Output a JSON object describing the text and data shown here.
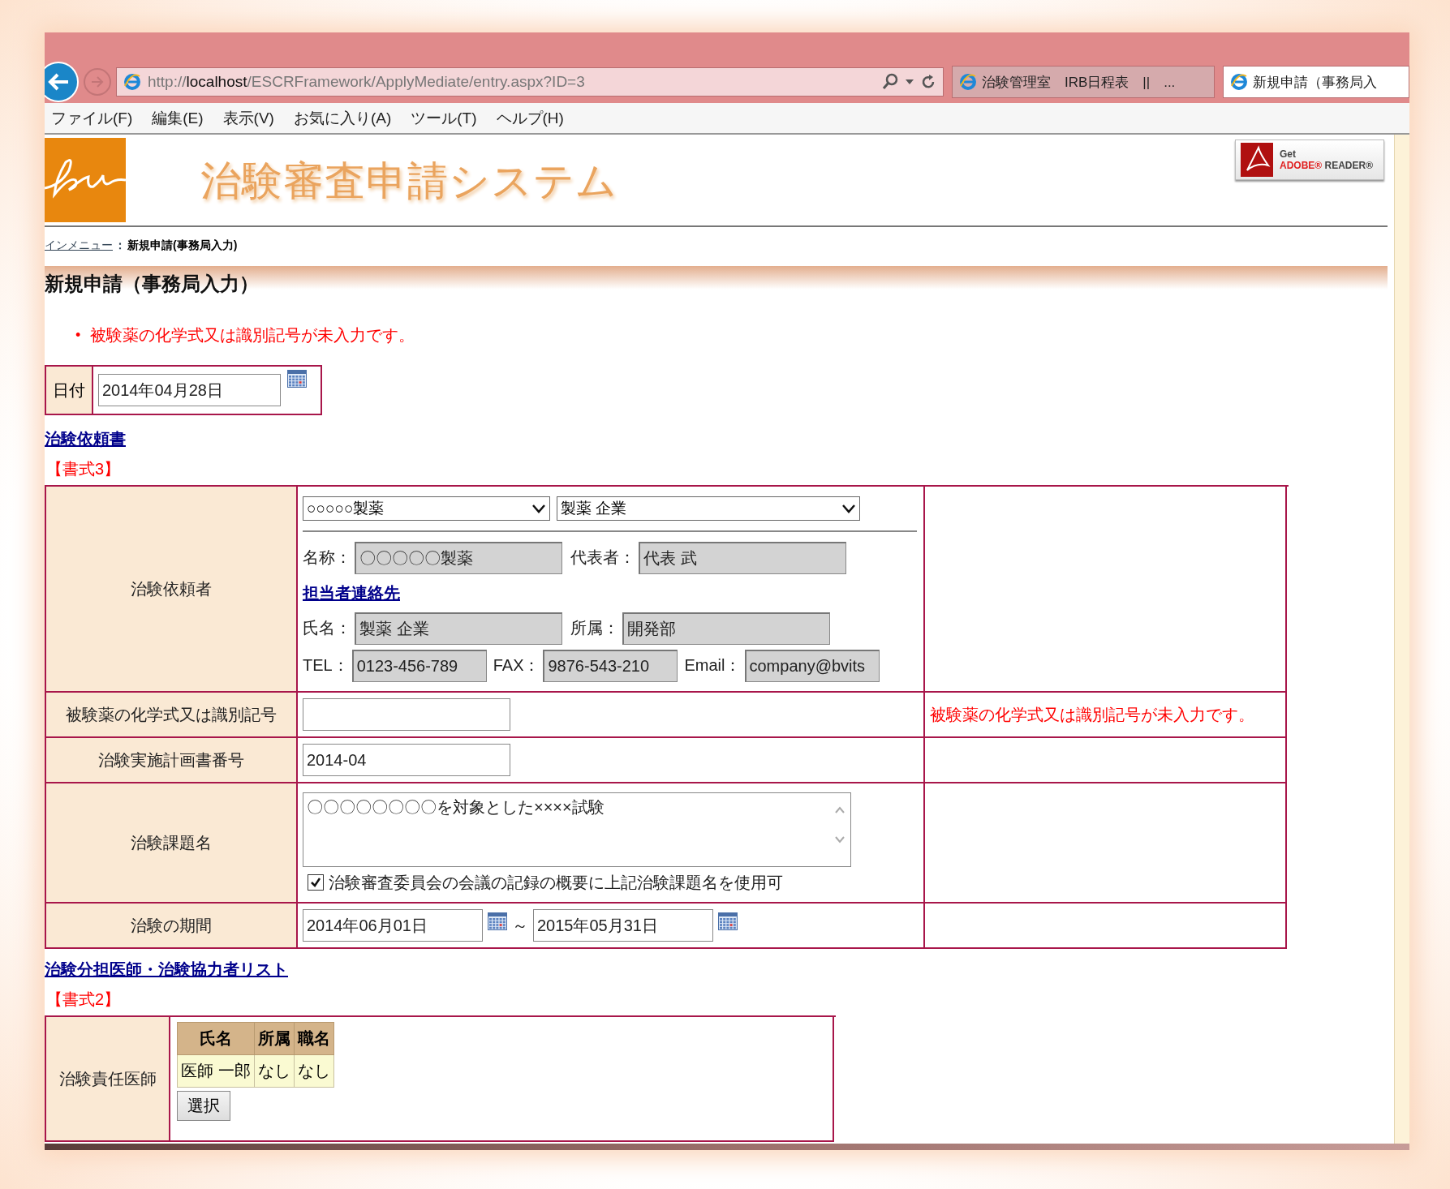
{
  "browser": {
    "url": {
      "scheme": "http://",
      "host": "localhost",
      "path": "/ESCRFramework/ApplyMediate/entry.aspx?ID=3"
    },
    "tabs": [
      {
        "title": "治験管理室　IRB日程表　||　...",
        "selected": false
      },
      {
        "title": "新規申請（事務局入",
        "selected": true
      }
    ],
    "menu": [
      "ファイル(F)",
      "編集(E)",
      "表示(V)",
      "お気に入り(A)",
      "ツール(T)",
      "ヘルプ(H)"
    ]
  },
  "header": {
    "title": "治験審査申請システム",
    "adobe": {
      "get": "Get",
      "brand": "ADOBE®",
      "product": "READER®"
    }
  },
  "breadcrumb": {
    "link": "インメニュー",
    "separator": "：",
    "current": "新規申請(事務局入力)"
  },
  "heading": "新規申請（事務局入力）",
  "errors": [
    {
      "bullet": "•",
      "text": "被験薬の化学式又は識別記号が未入力です。"
    }
  ],
  "date": {
    "label": "日付",
    "value": "2014年04月28日"
  },
  "sections": [
    {
      "link": "治験依頼書",
      "form": "【書式3】",
      "rows": [
        {
          "kind": "sponsor",
          "label": "治験依頼者",
          "selects": [
            "○○○○○製薬",
            "製薬 企業"
          ],
          "fields": [
            {
              "label": "名称：",
              "value": "〇〇〇〇〇製薬"
            },
            {
              "label": "代表者：",
              "value": "代表 武"
            }
          ],
          "contact_link": "担当者連絡先",
          "contact_fields": [
            {
              "label": "氏名：",
              "value": "製薬 企業"
            },
            {
              "label": "所属：",
              "value": "開発部"
            }
          ],
          "phone_fields": [
            {
              "label": "TEL：",
              "value": "0123-456-789"
            },
            {
              "label": "FAX：",
              "value": "9876-543-210"
            },
            {
              "label": "Email：",
              "value": "company@bvits"
            }
          ]
        },
        {
          "kind": "text",
          "label": "被験薬の化学式又は識別記号",
          "error": "被験薬の化学式又は識別記号が未入力です。"
        },
        {
          "kind": "text",
          "label": "治験実施計画書番号",
          "value": "2014-04"
        },
        {
          "kind": "textarea",
          "label": "治験課題名",
          "value": "〇〇〇〇〇〇〇〇を対象とした××××試験",
          "checkbox": {
            "label": "治験審査委員会の会議の記録の概要に上記治験課題名を使用可",
            "checked": true
          }
        },
        {
          "kind": "period",
          "label": "治験の期間",
          "from": "2014年06月01日",
          "separator": "～",
          "to": "2015年05月31日"
        }
      ]
    },
    {
      "link": "治験分担医師・治験協力者リスト",
      "form": "【書式2】",
      "rows": [
        {
          "kind": "doctors",
          "label": "治験責任医師",
          "columns": [
            "氏名",
            "所属",
            "職名"
          ],
          "table_rows": [
            [
              "医師 一郎",
              "なし",
              "なし"
            ]
          ],
          "button": "選択"
        }
      ]
    }
  ]
}
